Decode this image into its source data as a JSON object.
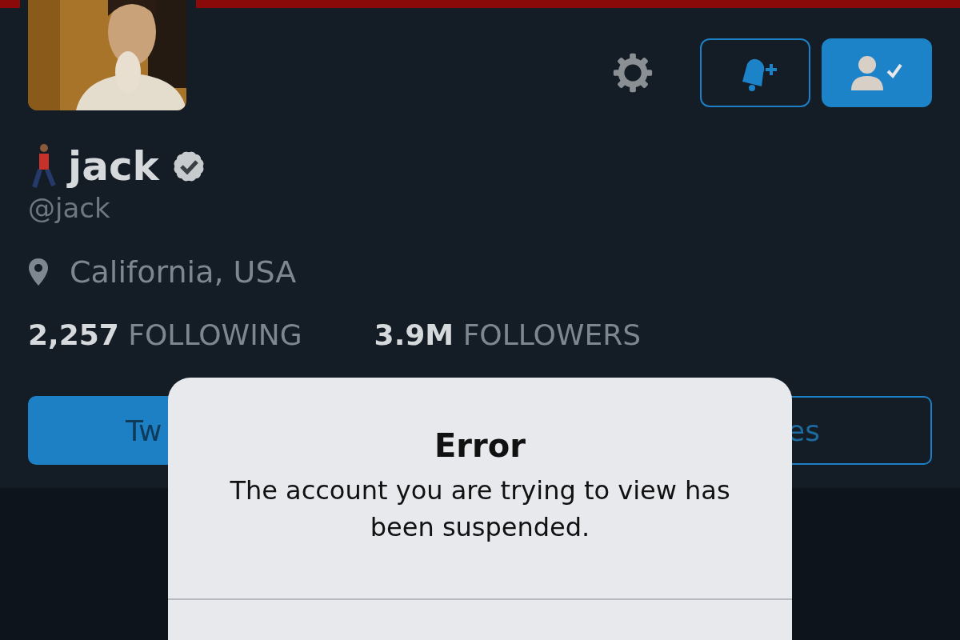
{
  "actions": [
    {
      "kind": "settings"
    },
    {
      "kind": "notify"
    },
    {
      "kind": "following"
    }
  ],
  "profile": {
    "display_name": "jack",
    "verified": true,
    "handle": "@jack",
    "location": "California, USA"
  },
  "stats": [
    {
      "value": "2,257",
      "label": "FOLLOWING"
    },
    {
      "value": "3.9M",
      "label": "FOLLOWERS"
    }
  ],
  "tabs": [
    {
      "label": "Tw",
      "selected": true
    },
    {
      "label": "es",
      "selected": false
    }
  ],
  "alert": {
    "title": "Error",
    "message": "The account you are trying to view has been suspended."
  }
}
